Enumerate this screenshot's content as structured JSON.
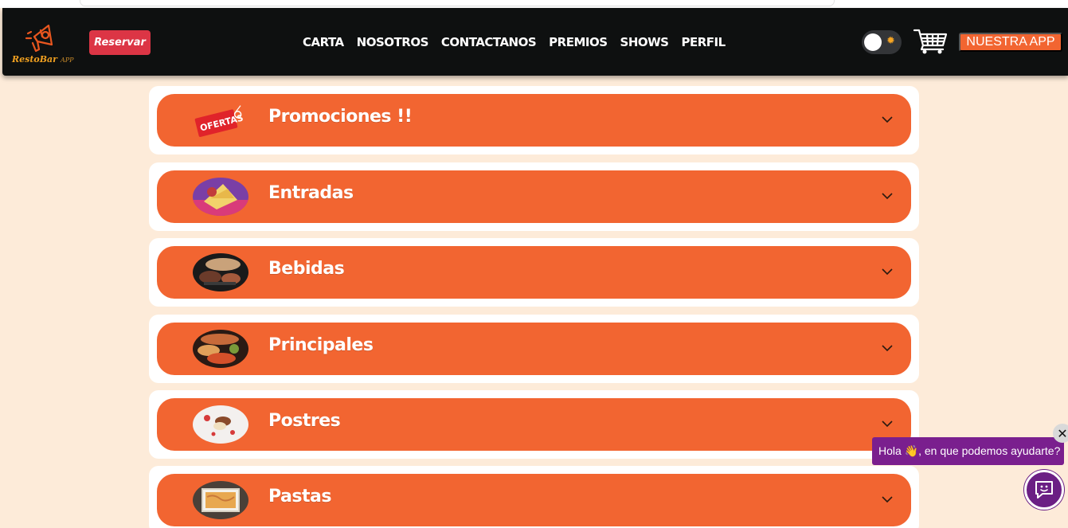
{
  "navbar": {
    "logo_text": "RestoBar",
    "logo_sub": "APP",
    "reserve_label": "Reservar",
    "links": [
      "CARTA",
      "NOSOTROS",
      "CONTACTANOS",
      "PREMIOS",
      "SHOWS",
      "PERFIL"
    ],
    "app_button_label": "NUESTRA APP",
    "theme_toggle_icon": "sun-icon",
    "cart_icon": "cart-icon"
  },
  "menu": {
    "categories": [
      {
        "title": "Promociones !!",
        "thumb": "ofertas-tag"
      },
      {
        "title": "Entradas",
        "thumb": "entradas-photo"
      },
      {
        "title": "Bebidas",
        "thumb": "bebidas-photo"
      },
      {
        "title": "Principales",
        "thumb": "principales-photo"
      },
      {
        "title": "Postres",
        "thumb": "postres-photo"
      },
      {
        "title": "Pastas",
        "thumb": "pastas-photo"
      }
    ],
    "promo_tag_text": "OFERTAS"
  },
  "chat": {
    "greeting": "Hola 👋, en que podemos ayudarte?",
    "close_icon": "close-icon",
    "fab_icon": "chat-bot-icon"
  },
  "colors": {
    "page_bg": "#fdebd9",
    "navbar_bg": "#0e1010",
    "accent_orange": "#f26531",
    "reserve_red": "#dc3545",
    "chat_purple": "#7a1f8e"
  }
}
